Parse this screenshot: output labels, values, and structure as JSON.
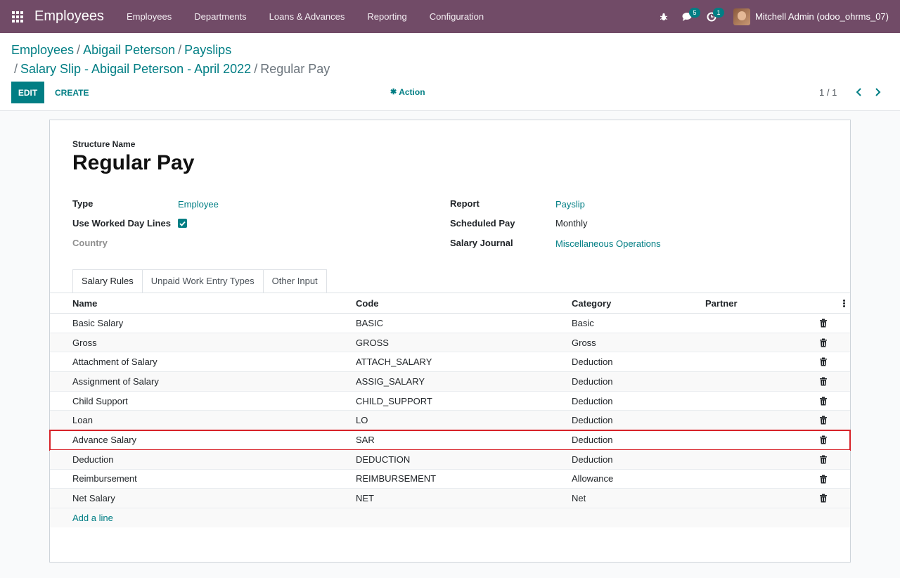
{
  "navbar": {
    "app_name": "Employees",
    "menu": [
      "Employees",
      "Departments",
      "Loans & Advances",
      "Reporting",
      "Configuration"
    ],
    "messages_badge": "5",
    "activities_badge": "1",
    "user": "Mitchell Admin (odoo_ohrms_07)"
  },
  "breadcrumb": {
    "items": [
      "Employees",
      "Abigail Peterson",
      "Payslips",
      "Salary Slip - Abigail Peterson - April 2022"
    ],
    "current": "Regular Pay"
  },
  "toolbar": {
    "edit": "EDIT",
    "create": "CREATE",
    "action": "Action",
    "pager": "1 / 1"
  },
  "form": {
    "structure_label": "Structure Name",
    "structure_name": "Regular Pay",
    "left": {
      "type_label": "Type",
      "type_value": "Employee",
      "worked_label": "Use Worked Day Lines",
      "worked_checked": true,
      "country_label": "Country"
    },
    "right": {
      "report_label": "Report",
      "report_value": "Payslip",
      "scheduled_label": "Scheduled Pay",
      "scheduled_value": "Monthly",
      "journal_label": "Salary Journal",
      "journal_value": "Miscellaneous Operations"
    }
  },
  "tabs": [
    "Salary Rules",
    "Unpaid Work Entry Types",
    "Other Input"
  ],
  "table": {
    "columns": [
      "Name",
      "Code",
      "Category",
      "Partner"
    ],
    "rows": [
      {
        "name": "Basic Salary",
        "code": "BASIC",
        "category": "Basic"
      },
      {
        "name": "Gross",
        "code": "GROSS",
        "category": "Gross"
      },
      {
        "name": "Attachment of Salary",
        "code": "ATTACH_SALARY",
        "category": "Deduction"
      },
      {
        "name": "Assignment of Salary",
        "code": "ASSIG_SALARY",
        "category": "Deduction"
      },
      {
        "name": "Child Support",
        "code": "CHILD_SUPPORT",
        "category": "Deduction"
      },
      {
        "name": "Loan",
        "code": "LO",
        "category": "Deduction"
      },
      {
        "name": "Advance Salary",
        "code": "SAR",
        "category": "Deduction"
      },
      {
        "name": "Deduction",
        "code": "DEDUCTION",
        "category": "Deduction"
      },
      {
        "name": "Reimbursement",
        "code": "REIMBURSEMENT",
        "category": "Allowance"
      },
      {
        "name": "Net Salary",
        "code": "NET",
        "category": "Net"
      }
    ],
    "add_line": "Add a line"
  },
  "colors": {
    "brand": "#714b67",
    "accent": "#017e84",
    "highlight": "#d72229"
  }
}
